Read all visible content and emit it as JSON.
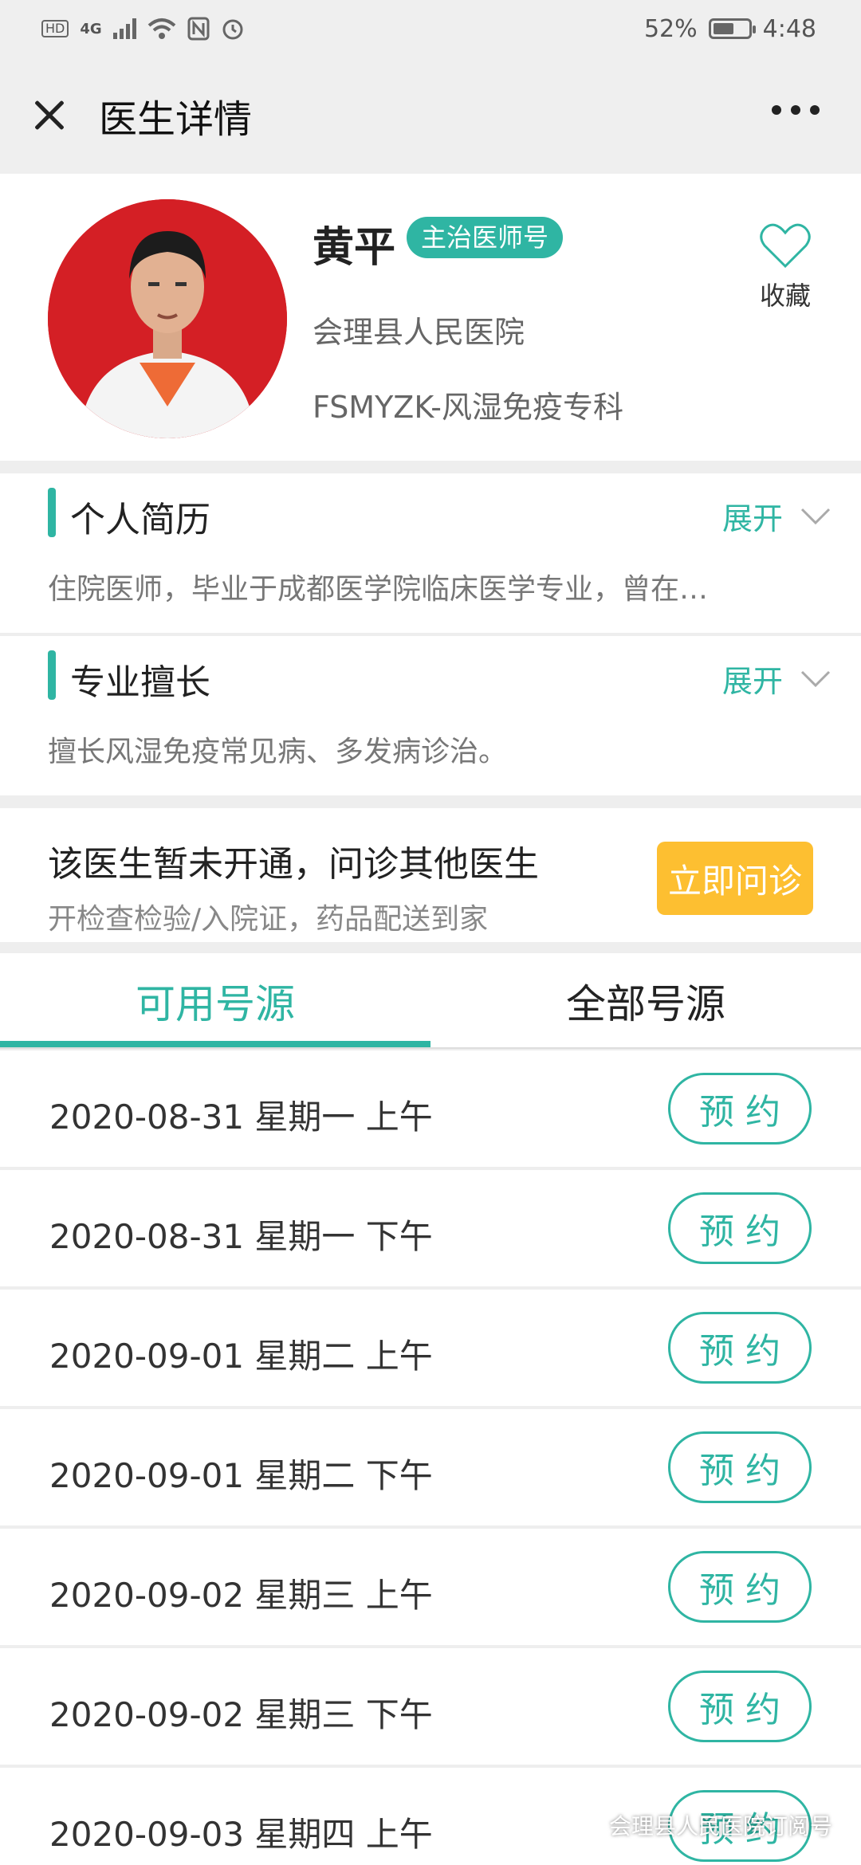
{
  "status_bar": {
    "network_badge": "HD",
    "network_type": "4G",
    "battery_percent": "52%",
    "battery_level": 0.52,
    "time": "4:48"
  },
  "header": {
    "title": "医生详情",
    "close_icon": "close-icon",
    "more_icon": "more-icon"
  },
  "doctor": {
    "name": "黄平",
    "title_badge": "主治医师号",
    "hospital": "会理县人民医院",
    "department": "FSMYZK-风湿免疫专科",
    "favorite_label": "收藏",
    "avatar_bg": "#d41f25"
  },
  "resume": {
    "title": "个人简历",
    "expand_label": "展开",
    "text": "住院医师，毕业于成都医学院临床医学专业，曾在…"
  },
  "specialty": {
    "title": "专业擅长",
    "expand_label": "展开",
    "text": "擅长风湿免疫常见病、多发病诊治。"
  },
  "consult": {
    "title": "该医生暂未开通，问诊其他医生",
    "subtitle": "开检查检验/入院证，药品配送到家",
    "button_label": "立即问诊"
  },
  "tabs": [
    {
      "label": "可用号源",
      "active": true
    },
    {
      "label": "全部号源",
      "active": false
    }
  ],
  "slots": [
    {
      "text": "2020-08-31 星期一 上午",
      "button": "预 约"
    },
    {
      "text": "2020-08-31 星期一 下午",
      "button": "预 约"
    },
    {
      "text": "2020-09-01 星期二 上午",
      "button": "预 约"
    },
    {
      "text": "2020-09-01 星期二 下午",
      "button": "预 约"
    },
    {
      "text": "2020-09-02 星期三 上午",
      "button": "预 约"
    },
    {
      "text": "2020-09-02 星期三 下午",
      "button": "预 约"
    },
    {
      "text": "2020-09-03 星期四 上午",
      "button": "预 约"
    }
  ],
  "watermark": "会理县人民医院订阅号",
  "colors": {
    "accent": "#2fb5a3",
    "consult_button": "#fdbf31"
  }
}
